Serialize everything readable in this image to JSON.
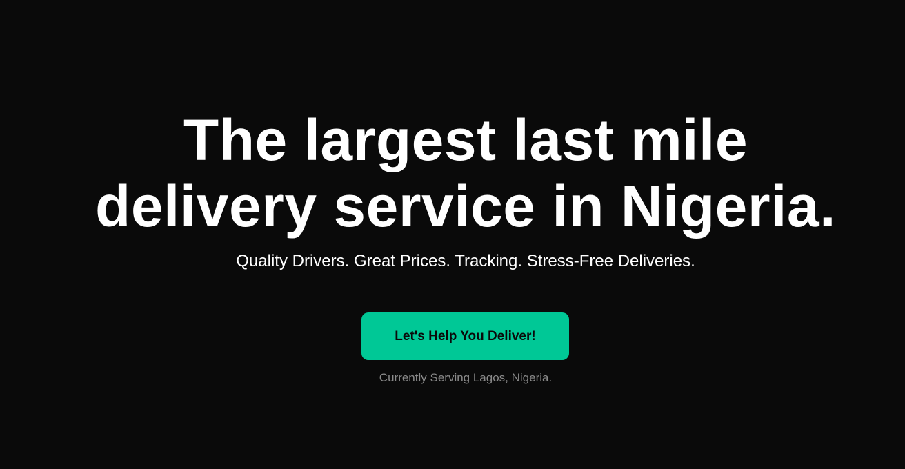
{
  "hero": {
    "headline_line1": "The largest last mile",
    "headline_line2": "delivery service in Nigeria.",
    "subtitle": "Quality Drivers. Great Prices. Tracking. Stress-Free Deliveries.",
    "cta_label": "Let's Help You Deliver!",
    "service_note": "Currently Serving Lagos, Nigeria."
  },
  "colors": {
    "background": "#0a0a0a",
    "accent": "#00c896",
    "text": "#ffffff",
    "muted_text": "#8a8a8a"
  }
}
